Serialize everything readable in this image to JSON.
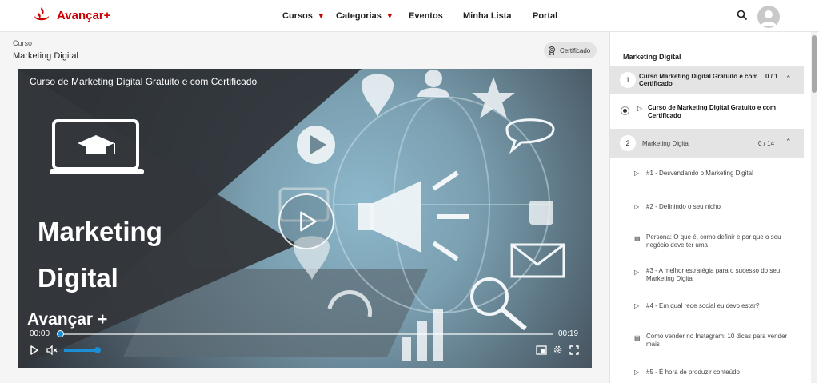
{
  "brand": {
    "name": "Avançar+",
    "color": "#cc0000"
  },
  "nav": {
    "items": [
      {
        "label": "Cursos",
        "has_dropdown": true
      },
      {
        "label": "Categorias",
        "has_dropdown": true
      },
      {
        "label": "Eventos",
        "has_dropdown": false
      },
      {
        "label": "Minha Lista",
        "has_dropdown": false
      },
      {
        "label": "Portal",
        "has_dropdown": false
      }
    ],
    "search_icon": "search-icon",
    "avatar_icon": "user-avatar-icon"
  },
  "breadcrumb": {
    "label": "Curso"
  },
  "course": {
    "title": "Marketing Digital"
  },
  "certificate": {
    "label": "Certificado",
    "icon": "certificate-icon"
  },
  "player": {
    "caption": "Curso de Marketing Digital Gratuito e com Certificado",
    "hero_line1": "Marketing",
    "hero_line2": "Digital",
    "hero_brand": "Avançar +",
    "time_current": "00:00",
    "time_total": "00:19",
    "progress": 0.0,
    "volume": 1.0,
    "icons": [
      "play-icon",
      "volume-icon",
      "pip-icon",
      "settings-icon",
      "fullscreen-icon"
    ]
  },
  "sidebar": {
    "title": "Marketing Digital",
    "sections": [
      {
        "number": "1",
        "title": "Curso Marketing Digital Gratuito e com Certificado",
        "count": "0 / 1",
        "expanded": true,
        "items": [
          {
            "type": "video",
            "title": "Curso de Marketing Digital Gratuito e com Certificado",
            "active": true
          }
        ]
      },
      {
        "number": "2",
        "title": "Marketing Digital",
        "count": "0 / 14",
        "expanded": true,
        "items": [
          {
            "type": "video",
            "title": "#1 - Desvendando o Marketing Digital"
          },
          {
            "type": "video",
            "title": "#2 - Definindo o seu nicho"
          },
          {
            "type": "article",
            "title": "Persona: O que é, como definir e por que o seu negócio deve ter uma"
          },
          {
            "type": "video",
            "title": "#3 - A melhor estratégia para o sucesso do seu Marketing Digital"
          },
          {
            "type": "video",
            "title": "#4 - Em qual rede social eu devo estar?"
          },
          {
            "type": "article",
            "title": "Como vender no Instagram: 10 dicas para vender mais"
          },
          {
            "type": "video",
            "title": "#5 - É hora de produzir conteúdo"
          }
        ]
      }
    ]
  }
}
